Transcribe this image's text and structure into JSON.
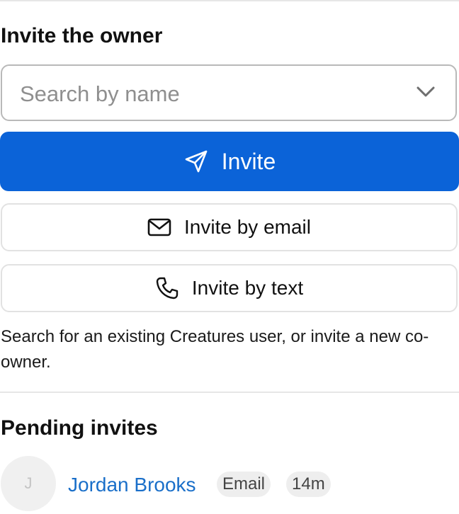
{
  "invite_section": {
    "title": "Invite the owner",
    "search": {
      "placeholder": "Search by name",
      "icon": "chevron-down-icon"
    },
    "invite_button": {
      "label": "Invite",
      "icon": "send-icon"
    },
    "invite_email_button": {
      "label": "Invite by email",
      "icon": "mail-icon"
    },
    "invite_text_button": {
      "label": "Invite by text",
      "icon": "phone-icon"
    },
    "help_text": "Search for an existing Creatures user, or invite a new co-owner."
  },
  "pending_section": {
    "title": "Pending invites",
    "invites": [
      {
        "avatar_initial": "J",
        "name": "Jordan Brooks",
        "method": "Email",
        "time": "14m"
      }
    ]
  },
  "colors": {
    "primary": "#0b63d8",
    "link": "#1a6fc9",
    "border": "#b9b9b9",
    "pill_bg": "#eeeeee"
  }
}
